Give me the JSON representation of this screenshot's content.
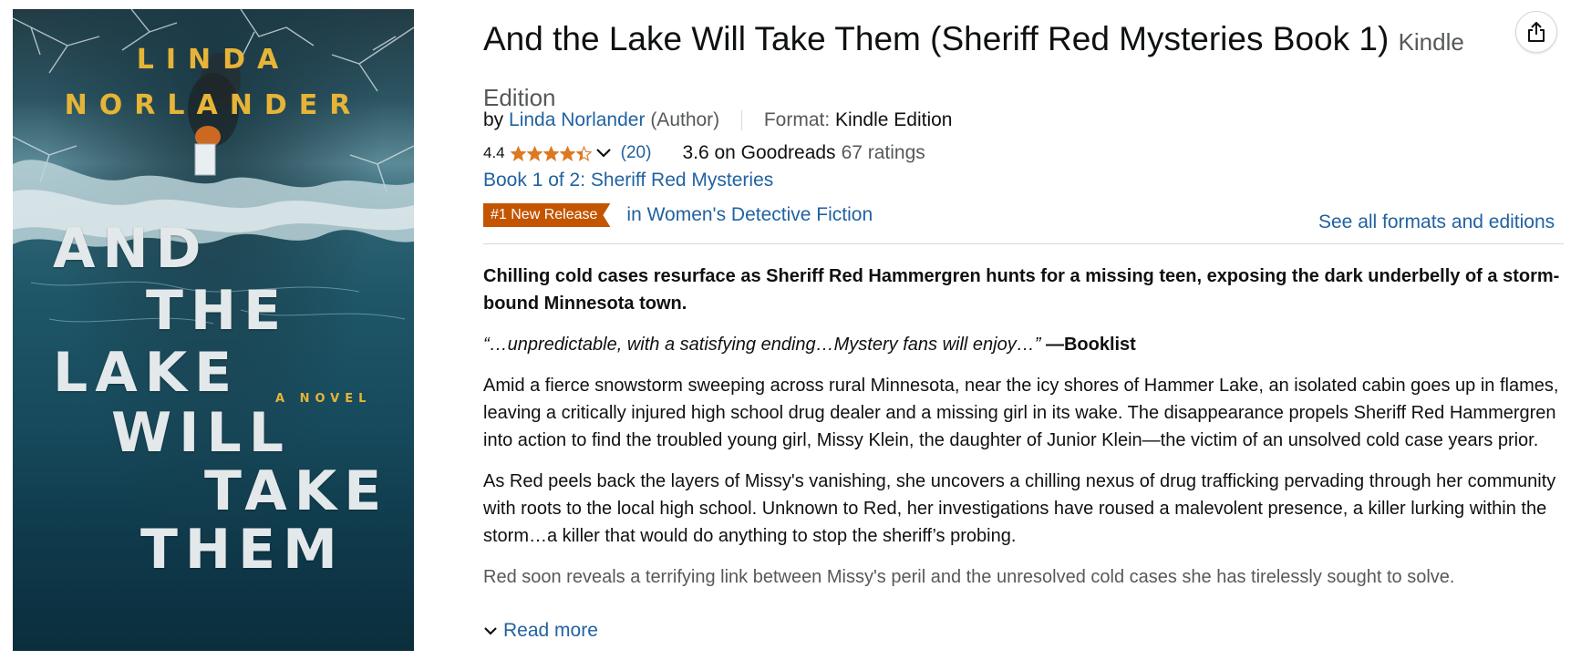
{
  "cover": {
    "author_first": "LINDA",
    "author_last": "NORLANDER",
    "title_words": [
      "AND",
      "THE",
      "LAKE",
      "WILL",
      "TAKE",
      "THEM"
    ],
    "tagline": "A NOVEL",
    "colors": {
      "author": "#e6b437",
      "title": "#e3e8ea",
      "water": "#164a5c"
    }
  },
  "product": {
    "title": "And the Lake Will Take Them (Sheriff Red Mysteries Book 1)",
    "edition": "Kindle Edition",
    "by": "by",
    "author_name": "Linda Norlander",
    "author_role": "(Author)",
    "format_label": "Format:",
    "format_value": "Kindle Edition",
    "rating_value": "4.4",
    "rating_stars": 4.4,
    "rating_count": "(20)",
    "goodreads_score": "3.6 on Goodreads",
    "goodreads_ratings": "67 ratings",
    "series": "Book 1 of 2: Sheriff Red Mysteries",
    "badge": "#1 New Release",
    "badge_category": "in Women's Detective Fiction",
    "see_all_formats": "See all formats and editions"
  },
  "description": {
    "lead": "Chilling cold cases resurface as Sheriff Red Hammergren hunts for a missing teen, exposing the dark underbelly of a storm-bound Minnesota town.",
    "quote": "“…unpredictable, with a satisfying ending…Mystery fans will enjoy…”",
    "quote_source": "—Booklist",
    "p1": "Amid a fierce snowstorm sweeping across rural Minnesota, near the icy shores of Hammer Lake, an isolated cabin goes up in flames, leaving a critically injured high school drug dealer and a missing girl in its wake. The disappearance propels Sheriff Red Hammergren into action to find the troubled young girl, Missy Klein, the daughter of Junior Klein—the victim of an unsolved cold case years prior.",
    "p2": "As Red peels back the layers of Missy's vanishing, she uncovers a chilling nexus of drug trafficking pervading through her community with roots to the local high school. Unknown to Red, her investigations have roused a malevolent presence, a killer lurking within the storm…a killer that would do anything to stop the sheriff’s probing.",
    "p3": "Red soon reveals a terrifying link between Missy's peril and the unresolved cold cases she has tirelessly sought to solve.",
    "read_more": "Read more"
  },
  "icons": {
    "share": "share-icon",
    "star": "star-icon",
    "chevron": "chevron-down-icon"
  },
  "colors": {
    "link": "#2162a1",
    "badge": "#c45500",
    "star": "#de7921",
    "muted": "#565959"
  }
}
